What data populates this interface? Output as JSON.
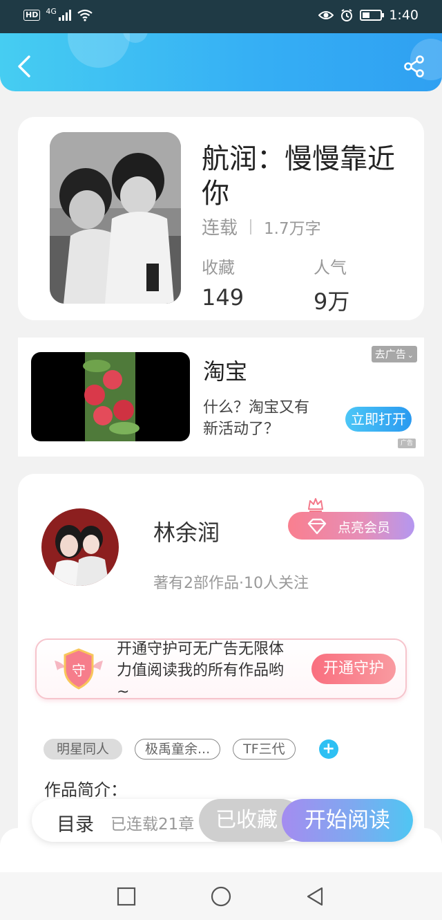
{
  "status_bar": {
    "network_badge": "HD",
    "network_type": "4G",
    "time": "1:40",
    "icons": [
      "signal-icon",
      "wifi-icon",
      "eye-icon",
      "alarm-icon",
      "battery-icon"
    ]
  },
  "header": {
    "icons": [
      "back-arrow-icon",
      "share-icon"
    ],
    "accent": "#35aef4"
  },
  "book": {
    "title": "航润：慢慢靠近你",
    "status": "连载",
    "word_count": "1.7万字",
    "stats": [
      {
        "label": "收藏",
        "value": "149"
      },
      {
        "label": "人气",
        "value": "9万"
      }
    ]
  },
  "ad": {
    "title": "淘宝",
    "description": "什么？淘宝又有新活动了？",
    "close_label": "去广告",
    "open_label": "立即打开",
    "tag_label": "广告"
  },
  "author": {
    "name": "林余润",
    "info": "著有2部作品·10人关注",
    "vip_label": "点亮会员",
    "guard_text": "开通守护可无广告无限体力值阅读我的所有作品哟~",
    "guard_button": "开通守护",
    "shield_char": "守"
  },
  "tags": [
    "明星同人",
    "极禹童余...",
    "TF三代"
  ],
  "intro_label": "作品简介：",
  "action_bar": {
    "toc_label": "目录",
    "toc_count": "已连载21章",
    "collect_label": "已收藏",
    "read_label": "开始阅读"
  },
  "nav": {
    "icons": [
      "recent-apps-icon",
      "home-icon",
      "back-triangle-icon"
    ]
  }
}
